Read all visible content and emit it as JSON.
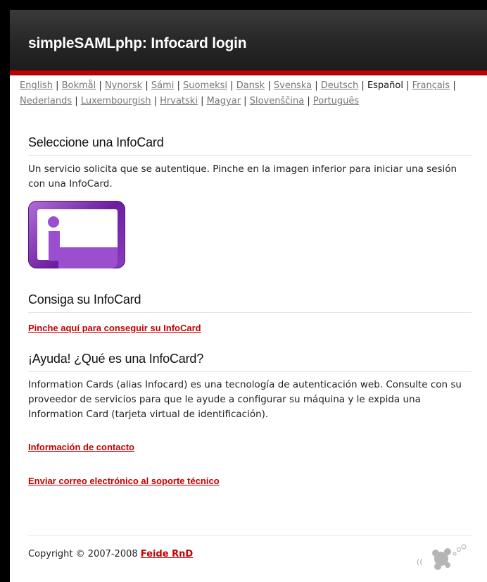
{
  "header": {
    "title": "simpleSAMLphp: Infocard login"
  },
  "languages": [
    {
      "label": "English",
      "current": false
    },
    {
      "label": "Bokmål",
      "current": false
    },
    {
      "label": "Nynorsk",
      "current": false
    },
    {
      "label": "Sámi",
      "current": false
    },
    {
      "label": "Suomeksi",
      "current": false
    },
    {
      "label": "Dansk",
      "current": false
    },
    {
      "label": "Svenska",
      "current": false
    },
    {
      "label": "Deutsch",
      "current": false
    },
    {
      "label": "Español",
      "current": true
    },
    {
      "label": "Français",
      "current": false
    },
    {
      "label": "Nederlands",
      "current": false
    },
    {
      "label": "Luxembourgish",
      "current": false
    },
    {
      "label": "Hrvatski",
      "current": false
    },
    {
      "label": "Magyar",
      "current": false
    },
    {
      "label": "Slovenščina",
      "current": false
    },
    {
      "label": "Português",
      "current": false
    }
  ],
  "select": {
    "heading": "Seleccione una InfoCard",
    "text": "Un servicio solicita que se autentique. Pinche en la imagen inferior para iniciar una sesión con una InfoCard."
  },
  "get_card": {
    "heading": "Consiga su InfoCard",
    "link": "Pinche aquí para conseguir su InfoCard"
  },
  "help": {
    "heading": "¡Ayuda! ¿Qué es una InfoCard?",
    "text": "Information Cards (alias Infocard) es una tecnología de autenticación web. Consulte con su proveedor de servicios para que le ayude a configurar su máquina y le expida una Information Card (tarjeta virtual de identificación).",
    "contact_link": "Información de contacto",
    "support_link": "Enviar correo electrónico al soporte técnico"
  },
  "footer": {
    "copyright": "Copyright © 2007-2008",
    "owner_link": "Feide RnD"
  },
  "icons": {
    "infocard": "infocard-icon",
    "logo": "simplesamlphp-logo"
  },
  "colors": {
    "accent": "#c40000",
    "header": "#262626",
    "card": "#7b2aad"
  }
}
